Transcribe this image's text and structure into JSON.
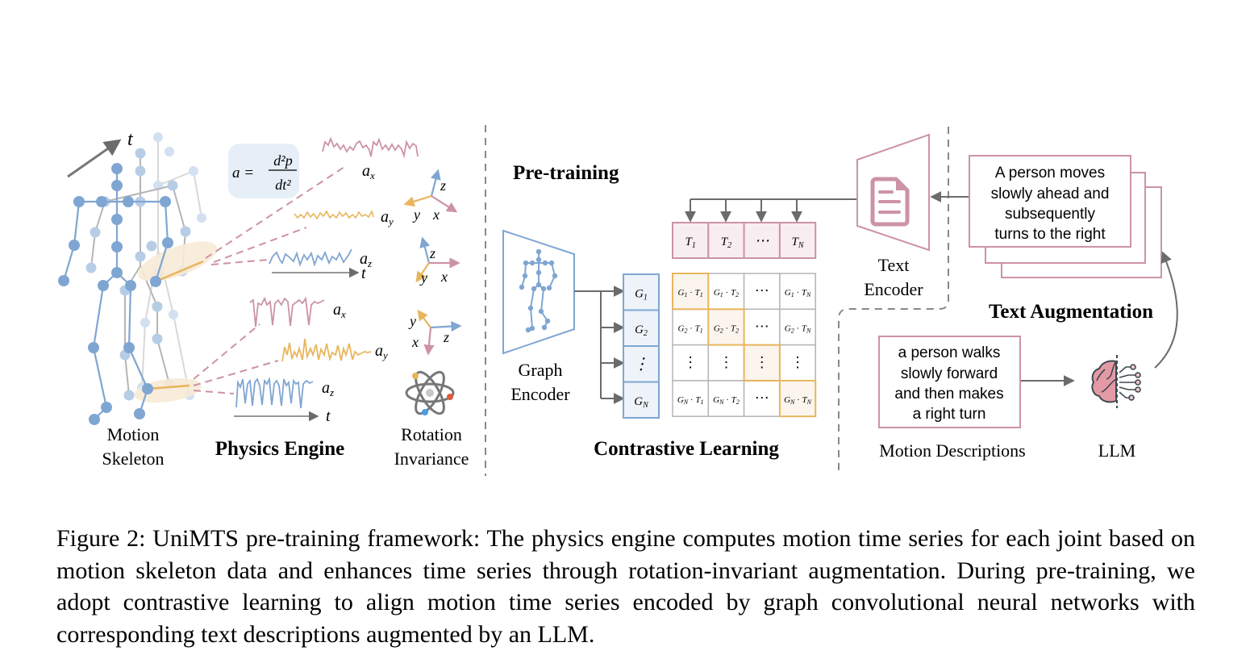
{
  "colors": {
    "blue": "#7fa6d2",
    "pink": "#cc93a4",
    "orange": "#e8b55c",
    "gray": "#6b6b6b",
    "light_blue_fill": "#eef3fa",
    "light_pink_fill": "#f8eef1",
    "light_orange_fill": "#fbf5ed",
    "formula_bg": "#e6eef7"
  },
  "physics": {
    "time_axis_label": "t",
    "formula_lhs": "a =",
    "formula_num": "d²p",
    "formula_den": "dt²",
    "signals_upper": [
      "a",
      "a",
      "a"
    ],
    "signals_upper_sub": [
      "x",
      "y",
      "z"
    ],
    "signals_lower": [
      "a",
      "a",
      "a"
    ],
    "signals_lower_sub": [
      "x",
      "y",
      "z"
    ],
    "t_label_upper": "t",
    "t_label_lower": "t",
    "axes_1": {
      "x": "x",
      "y": "y",
      "z": "z"
    },
    "axes_2": {
      "x": "x",
      "y": "y",
      "z": "z"
    },
    "axes_3": {
      "x": "x",
      "y": "y",
      "z": "z"
    },
    "label_skeleton_1": "Motion",
    "label_skeleton_2": "Skeleton",
    "label_engine": "Physics Engine",
    "label_rotation_1": "Rotation",
    "label_rotation_2": "Invariance"
  },
  "pretraining": {
    "title": "Pre-training",
    "graph_encoder_1": "Graph",
    "graph_encoder_2": "Encoder",
    "text_encoder_1": "Text",
    "text_encoder_2": "Encoder",
    "contrastive_title": "Contrastive Learning",
    "t_embeddings": [
      {
        "base": "T",
        "sub": "1"
      },
      {
        "base": "T",
        "sub": "2"
      },
      {
        "base": "⋯",
        "sub": ""
      },
      {
        "base": "T",
        "sub": "N"
      }
    ],
    "g_embeddings": [
      {
        "base": "G",
        "sub": "1"
      },
      {
        "base": "G",
        "sub": "2"
      },
      {
        "base": "⋮",
        "sub": ""
      },
      {
        "base": "G",
        "sub": "N"
      }
    ],
    "matrix": [
      [
        {
          "g": "1",
          "t": "1"
        },
        {
          "g": "1",
          "t": "2"
        },
        {
          "dots": "⋯"
        },
        {
          "g": "1",
          "t": "N"
        }
      ],
      [
        {
          "g": "2",
          "t": "1"
        },
        {
          "g": "2",
          "t": "2"
        },
        {
          "dots": "⋯"
        },
        {
          "g": "2",
          "t": "N"
        }
      ],
      [
        {
          "dots": "⋮"
        },
        {
          "dots": "⋮"
        },
        {
          "dots": "⋮"
        },
        {
          "dots": "⋮"
        }
      ],
      [
        {
          "g": "N",
          "t": "1"
        },
        {
          "g": "N",
          "t": "2"
        },
        {
          "dots": "⋯"
        },
        {
          "g": "N",
          "t": "N"
        }
      ]
    ]
  },
  "augmentation": {
    "title": "Text Augmentation",
    "augmented_text": [
      "A person moves",
      "slowly ahead and",
      "subsequently",
      "turns to the right"
    ],
    "original_text": [
      "a person walks",
      "slowly forward",
      "and then makes",
      "a right turn"
    ],
    "label_descriptions": "Motion Descriptions",
    "label_llm": "LLM"
  },
  "caption": "Figure 2: UniMTS pre-training framework: The physics engine computes motion time series for each joint based on motion skeleton data and enhances time series through rotation-invariant augmentation. During pre-training, we adopt contrastive learning to align motion time series encoded by graph convolutional neural networks with corresponding text descriptions augmented by an LLM."
}
